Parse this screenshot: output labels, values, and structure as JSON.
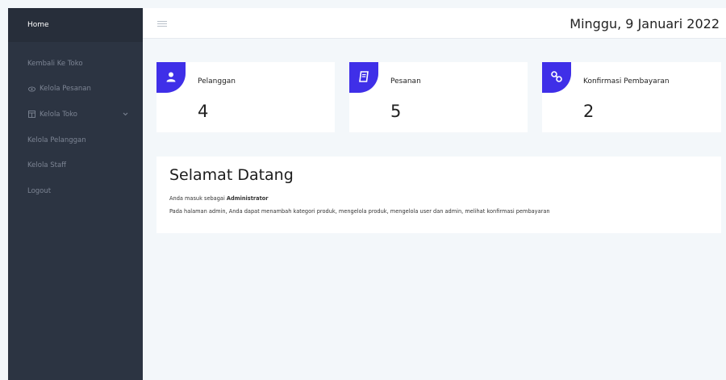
{
  "sidebar": {
    "active": "Home",
    "items": [
      {
        "label": "Kembali Ke Toko",
        "icon": ""
      },
      {
        "label": "Kelola Pesanan",
        "icon": "eye-icon"
      },
      {
        "label": "Kelola Toko",
        "icon": "store-icon",
        "chevron": "chevron-down-icon"
      },
      {
        "label": "Kelola Pelanggan",
        "icon": ""
      },
      {
        "label": "Kelola Staff",
        "icon": ""
      },
      {
        "label": "Logout",
        "icon": ""
      }
    ]
  },
  "header": {
    "date": "Minggu, 9 Januari 2022"
  },
  "cards": [
    {
      "title": "Pelanggan",
      "value": "4",
      "icon": "user-icon"
    },
    {
      "title": "Pesanan",
      "value": "5",
      "icon": "book-icon"
    },
    {
      "title": "Konfirmasi Pembayaran",
      "value": "2",
      "icon": "link-icon"
    }
  ],
  "welcome": {
    "title": "Selamat Datang",
    "line1_prefix": "Anda masuk sebagai ",
    "line1_role": "Administrator",
    "line2": "Pada halaman admin, Anda dapat menambah kategori produk, mengelola produk, mengelola user dan admin, melihat konfirmasi pembayaran"
  },
  "colors": {
    "sidebar": "#2c3442",
    "accent": "#3f2fe8",
    "background": "#f3f7fa"
  }
}
